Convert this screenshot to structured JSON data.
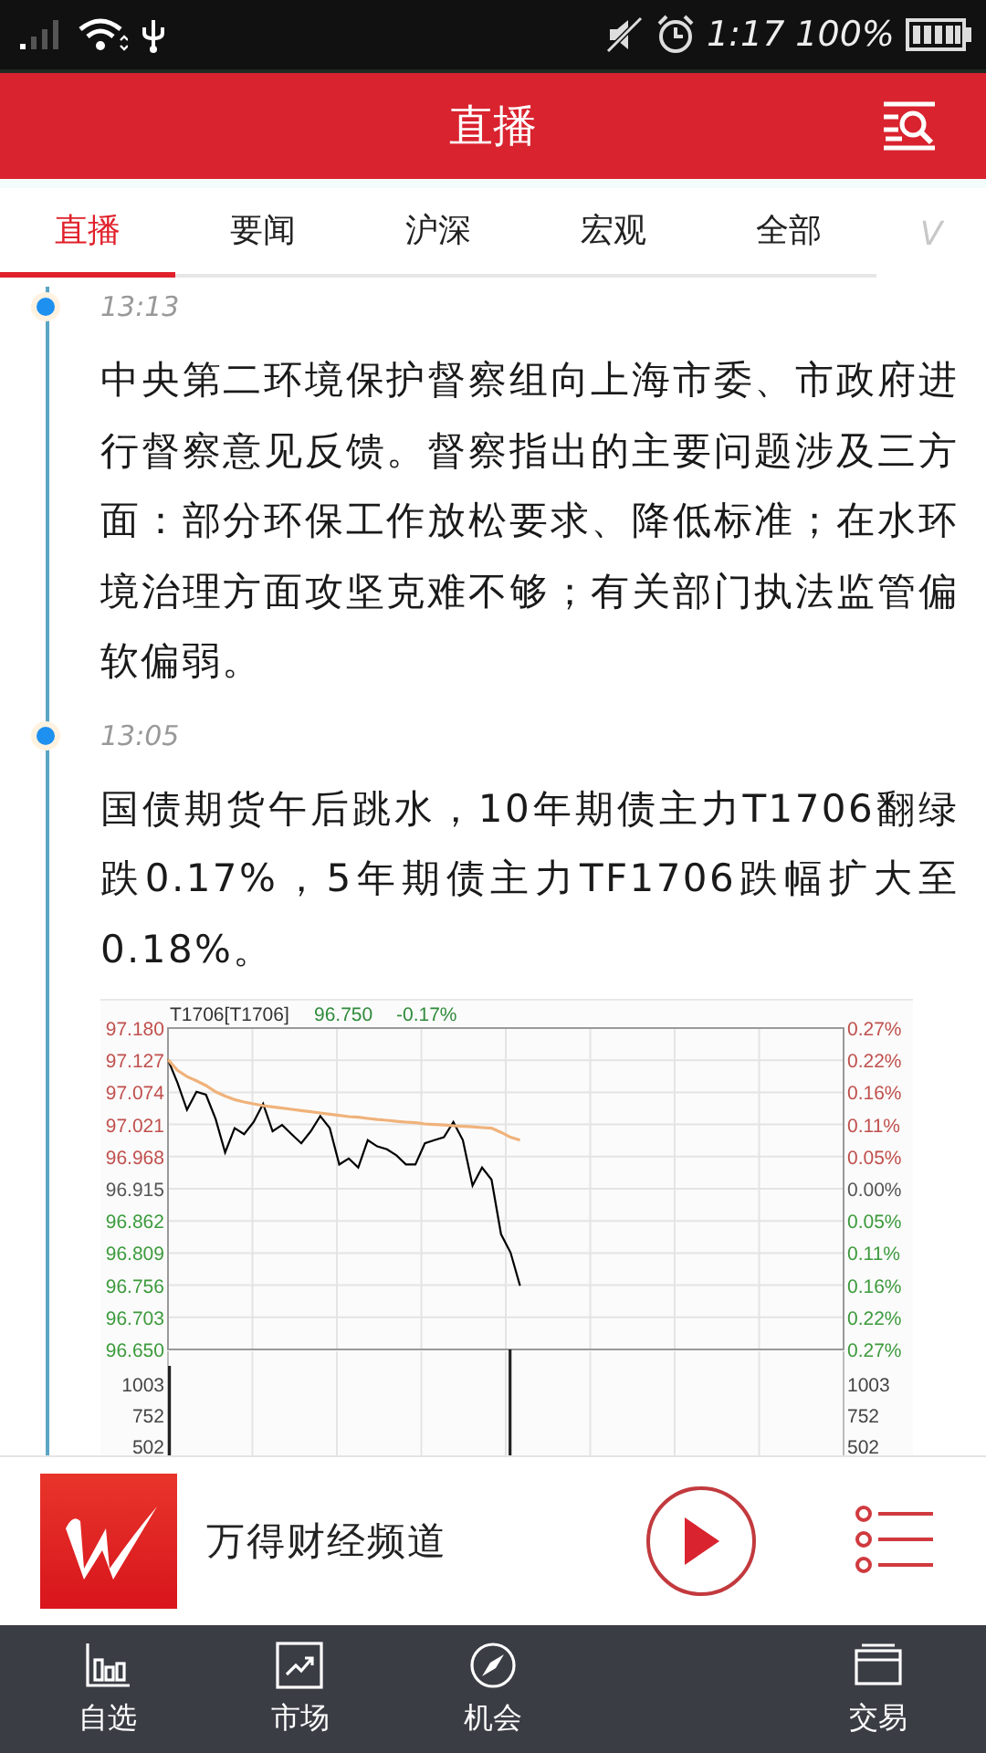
{
  "status_bar": {
    "time": "1:17",
    "battery": "100%"
  },
  "header": {
    "title": "直播"
  },
  "tabs": [
    {
      "label": "直播",
      "selected": true
    },
    {
      "label": "要闻",
      "selected": false
    },
    {
      "label": "沪深",
      "selected": false
    },
    {
      "label": "宏观",
      "selected": false
    },
    {
      "label": "全部",
      "selected": false
    }
  ],
  "tabs_more": "V",
  "feed": [
    {
      "time": "13:13",
      "text": "中央第二环境保护督察组向上海市委、市政府进行督察意见反馈。督察指出的主要问题涉及三方面：部分环保工作放松要求、降低标准；在水环境治理方面攻坚克难不够；有关部门执法监管偏软偏弱。"
    },
    {
      "time": "13:05",
      "text": "国债期货午后跳水，10年期债主力T1706翻绿跌0.17%，5年期债主力TF1706跌幅扩大至0.18%。",
      "quote": {
        "symbol": "T1706[T1706]",
        "price": "96.750",
        "change": "-0.17%"
      },
      "price_chart": {
        "right_labels": [
          "0.27%",
          "0.22%",
          "0.16%",
          "0.11%",
          "0.05%",
          "0.00%",
          "0.05%",
          "0.11%",
          "0.16%",
          "0.22%",
          "0.27%"
        ],
        "chart_data": {
          "type": "line",
          "grid": true,
          "categories": [
            null,
            null,
            null,
            null,
            null,
            null,
            null,
            null,
            null,
            null,
            null,
            null,
            null,
            null,
            null,
            null,
            null,
            null,
            null,
            null,
            null,
            null,
            null,
            null,
            null,
            null,
            null,
            null,
            null,
            null,
            null,
            null,
            null,
            null,
            null,
            null,
            null,
            null,
            null,
            null,
            null,
            null,
            null,
            null,
            null,
            null,
            null,
            null,
            null,
            null,
            null,
            null,
            null,
            null,
            null,
            null,
            null,
            null,
            null,
            null,
            null,
            null,
            null,
            null,
            null,
            null,
            null,
            null,
            null,
            null,
            null,
            null
          ],
          "ylim": [
            96.65,
            97.18
          ],
          "yticks": [
            {
              "value": 97.18,
              "label": "97.180"
            },
            {
              "value": 97.127,
              "label": "97.127"
            },
            {
              "value": 97.074,
              "label": "97.074"
            },
            {
              "value": 97.021,
              "label": "97.021"
            },
            {
              "value": 96.968,
              "label": "96.968"
            },
            {
              "value": 96.915,
              "label": "96.915"
            },
            {
              "value": 96.862,
              "label": "96.862"
            },
            {
              "value": 96.809,
              "label": "96.809"
            },
            {
              "value": 96.756,
              "label": "96.756"
            },
            {
              "value": 96.703,
              "label": "96.703"
            },
            {
              "value": 96.65,
              "label": "96.650"
            }
          ],
          "series": [
            {
              "color": "#000000",
              "values": [
                97.128,
                97.09,
                97.045,
                97.075,
                97.07,
                97.03,
                96.975,
                97.015,
                97.005,
                97.025,
                97.055,
                97.01,
                97.02,
                97.005,
                96.99,
                97.01,
                97.035,
                97.015,
                96.955,
                96.965,
                96.95,
                96.995,
                96.985,
                96.98,
                96.97,
                96.955,
                96.955,
                96.99,
                96.995,
                97.0,
                97.025,
                96.995,
                96.92,
                96.95,
                96.93,
                96.84,
                96.81,
                96.755,
                null,
                null,
                null,
                null,
                null,
                null,
                null,
                null,
                null,
                null,
                null,
                null,
                null,
                null,
                null,
                null,
                null,
                null,
                null,
                null,
                null,
                null,
                null,
                null,
                null,
                null,
                null,
                null,
                null,
                null,
                null,
                null,
                null,
                null
              ]
            },
            {
              "color": "#f0b27a",
              "values": [
                97.128,
                97.11,
                97.1,
                97.093,
                97.085,
                97.075,
                97.068,
                97.062,
                97.058,
                97.055,
                97.052,
                97.05,
                97.048,
                97.046,
                97.044,
                97.042,
                97.04,
                97.038,
                97.036,
                97.034,
                97.033,
                97.031,
                97.029,
                97.028,
                97.026,
                97.025,
                97.024,
                97.022,
                97.021,
                97.02,
                97.019,
                97.018,
                97.017,
                97.016,
                97.015,
                97.008,
                97.0,
                96.995,
                null,
                null,
                null,
                null,
                null,
                null,
                null,
                null,
                null,
                null,
                null,
                null,
                null,
                null,
                null,
                null,
                null,
                null,
                null,
                null,
                null,
                null,
                null,
                null,
                null,
                null,
                null,
                null,
                null,
                null,
                null,
                null,
                null,
                null
              ]
            }
          ]
        }
      },
      "volume_axis": {
        "left_labels": [
          "1003",
          "752",
          "502"
        ],
        "right_labels": [
          "1003",
          "752",
          "502"
        ]
      }
    }
  ],
  "player": {
    "title": "万得财经频道"
  },
  "bottom_nav": [
    {
      "label": "自选",
      "kind": "watchlist"
    },
    {
      "label": "市场",
      "kind": "market"
    },
    {
      "label": "机会",
      "kind": "compass"
    },
    {
      "label": "交易",
      "kind": "trade"
    }
  ]
}
